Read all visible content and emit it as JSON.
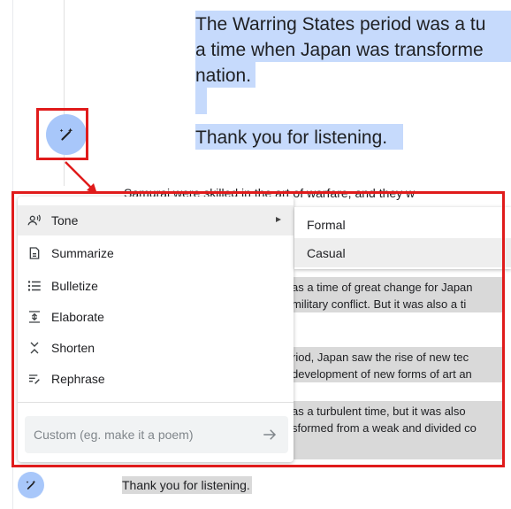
{
  "document": {
    "top_lines": [
      "The Warring States period was a tu",
      "a time when Japan was transforme",
      "nation.",
      "Thank you for listening."
    ],
    "obscured_line": "Samurai were skilled in the art of warfare, and they w",
    "behind_menu_lines": [
      "as a time of great change for Japan",
      "military conflict. But it was also a ti",
      "riod, Japan saw the rise of new tec",
      "development of new forms of art an",
      "as a turbulent time, but it was also",
      "sformed from a weak and divided co"
    ],
    "bottom_line": "Thank you for listening."
  },
  "menu": {
    "items": [
      {
        "label": "Tone",
        "icon": "tone-icon",
        "has_submenu": true
      },
      {
        "label": "Summarize",
        "icon": "summarize-icon"
      },
      {
        "label": "Bulletize",
        "icon": "bulletize-icon"
      },
      {
        "label": "Elaborate",
        "icon": "elaborate-icon"
      },
      {
        "label": "Shorten",
        "icon": "shorten-icon"
      },
      {
        "label": "Rephrase",
        "icon": "rephrase-icon"
      }
    ],
    "custom_placeholder": "Custom (eg. make it a poem)"
  },
  "submenu": {
    "items": [
      {
        "label": "Formal"
      },
      {
        "label": "Casual"
      }
    ]
  },
  "colors": {
    "selection_blue": "#c6dafc",
    "ai_button": "#a8c7fa",
    "annotation_red": "#e01b1b",
    "text_gray_highlight": "#d9d9d9"
  }
}
